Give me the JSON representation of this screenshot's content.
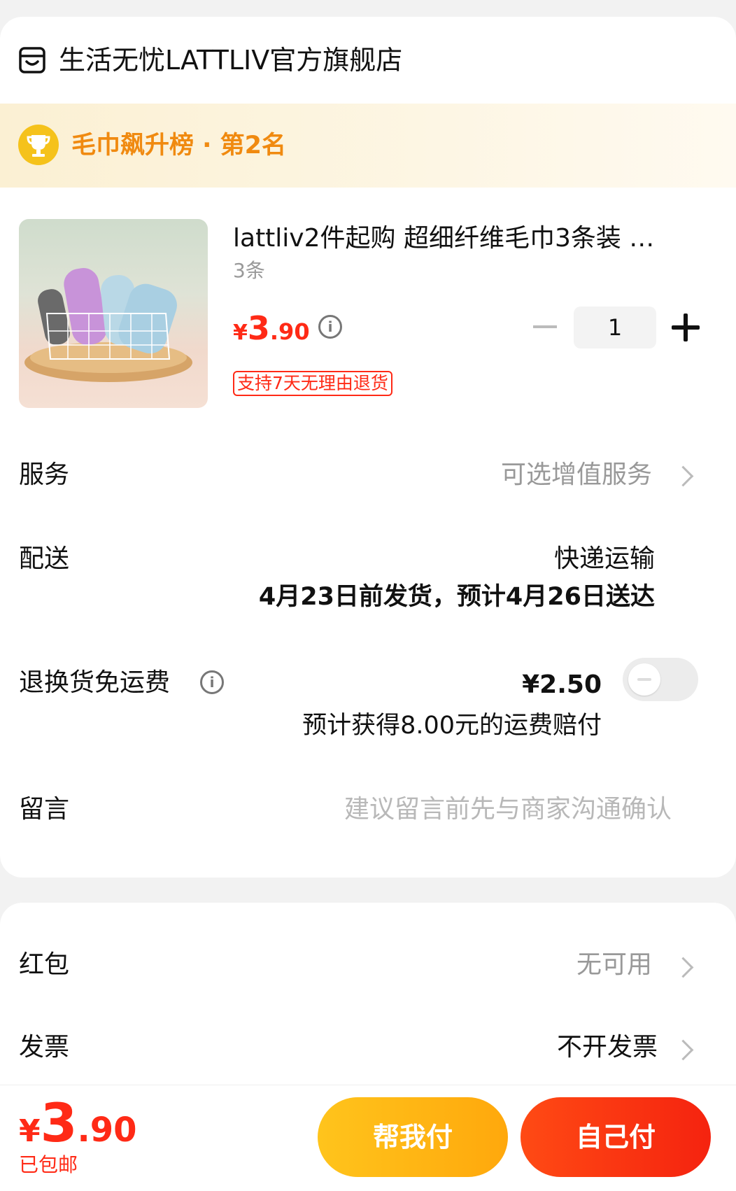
{
  "store": {
    "name": "生活无忧LATTLIV官方旗舰店",
    "icon": "store-icon"
  },
  "ranking": {
    "text": "毛巾飙升榜 · 第2名",
    "icon": "trophy-icon"
  },
  "product": {
    "title": "lattliv2件起购  超细纤维毛巾3条装 …",
    "spec": "3条",
    "price_currency": "¥",
    "price_int": "3",
    "price_dec": ".90",
    "quantity": "1",
    "return_tag": "支持7天无理由退货"
  },
  "service": {
    "label": "服务",
    "value": "可选增值服务"
  },
  "delivery": {
    "label": "配送",
    "method": "快递运输",
    "schedule": "4月23日前发货，预计4月26日送达"
  },
  "return_shipping": {
    "label": "退换货免运费",
    "price": "¥2.50",
    "compensation": "预计获得8.00元的运费赔付",
    "enabled": false
  },
  "message": {
    "label": "留言",
    "placeholder": "建议留言前先与商家沟通确认"
  },
  "red_packet": {
    "label": "红包",
    "value": "无可用"
  },
  "invoice": {
    "label": "发票",
    "value": "不开发票"
  },
  "footer": {
    "total_currency": "¥",
    "total_int": "3",
    "total_dec": ".90",
    "shipping_note": "已包邮",
    "pay_for_me_label": "帮我付",
    "pay_self_label": "自己付"
  },
  "colors": {
    "accent": "#ff2a16",
    "rank": "#f08a10",
    "friend_btn": "#ffb416",
    "self_btn": "#f5230f"
  }
}
